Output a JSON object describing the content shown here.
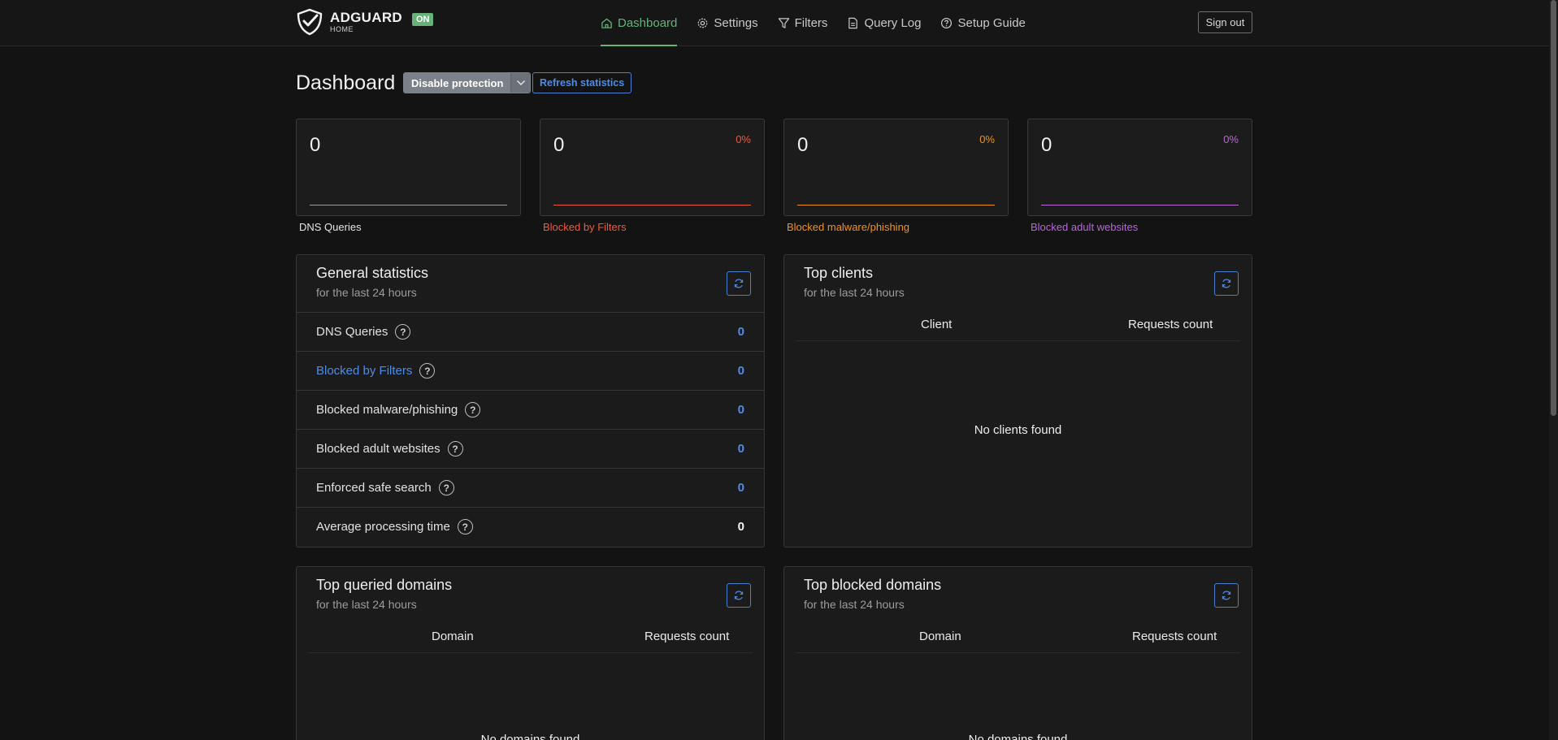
{
  "header": {
    "logo_title": "ADGUARD",
    "logo_sub": "HOME",
    "status_badge": "ON",
    "nav": [
      {
        "label": "Dashboard",
        "icon": "home-icon",
        "active": true
      },
      {
        "label": "Settings",
        "icon": "gear-icon",
        "active": false
      },
      {
        "label": "Filters",
        "icon": "filter-icon",
        "active": false
      },
      {
        "label": "Query Log",
        "icon": "document-icon",
        "active": false
      },
      {
        "label": "Setup Guide",
        "icon": "help-circle-icon",
        "active": false
      }
    ],
    "signout_label": "Sign out"
  },
  "page": {
    "title": "Dashboard",
    "disable_label": "Disable protection",
    "refresh_label": "Refresh statistics"
  },
  "stat_cards": [
    {
      "value": "0",
      "percent": "",
      "label": "DNS Queries",
      "color": "#9a9a9a"
    },
    {
      "value": "0",
      "percent": "0%",
      "label": "Blocked by Filters",
      "color": "#ef5a3c"
    },
    {
      "value": "0",
      "percent": "0%",
      "label": "Blocked malware/phishing",
      "color": "#f29221"
    },
    {
      "value": "0",
      "percent": "0%",
      "label": "Blocked adult websites",
      "color": "#b768d6"
    }
  ],
  "general": {
    "title": "General statistics",
    "subtitle": "for the last 24 hours",
    "rows": [
      {
        "label": "DNS Queries",
        "value": "0"
      },
      {
        "label": "Blocked by Filters",
        "value": "0"
      },
      {
        "label": "Blocked malware/phishing",
        "value": "0"
      },
      {
        "label": "Blocked adult websites",
        "value": "0"
      },
      {
        "label": "Enforced safe search",
        "value": "0"
      },
      {
        "label": "Average processing time",
        "value": "0"
      }
    ],
    "help_glyph": "?"
  },
  "top_clients": {
    "title": "Top clients",
    "subtitle": "for the last 24 hours",
    "col_client": "Client",
    "col_count": "Requests count",
    "empty": "No clients found"
  },
  "top_queried": {
    "title": "Top queried domains",
    "subtitle": "for the last 24 hours",
    "col_domain": "Domain",
    "col_count": "Requests count",
    "empty": "No domains found"
  },
  "top_blocked": {
    "title": "Top blocked domains",
    "subtitle": "for the last 24 hours",
    "col_domain": "Domain",
    "col_count": "Requests count",
    "empty": "No domains found"
  },
  "colors": {
    "accent_green": "#67b279",
    "link_blue": "#4f8ce6"
  }
}
